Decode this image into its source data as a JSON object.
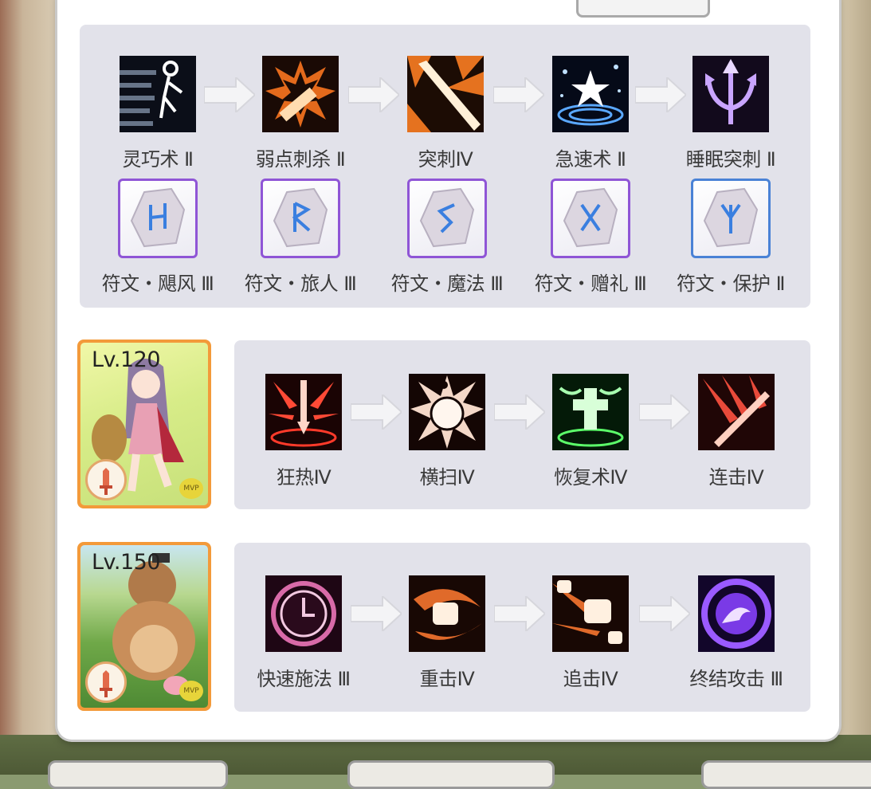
{
  "row1": [
    {
      "label": "灵巧术 Ⅱ",
      "icon": "agility-dash-icon"
    },
    {
      "label": "弱点刺杀 Ⅱ",
      "icon": "weak-point-stab-icon"
    },
    {
      "label": "突刺Ⅳ",
      "icon": "thrust-icon"
    },
    {
      "label": "急速术 Ⅱ",
      "icon": "haste-icon"
    },
    {
      "label": "睡眠突刺 Ⅱ",
      "icon": "sleep-thrust-icon"
    }
  ],
  "runes": [
    {
      "label": "符文・飓风 Ⅲ",
      "icon": "rune-hurricane-icon"
    },
    {
      "label": "符文・旅人 Ⅲ",
      "icon": "rune-traveler-icon"
    },
    {
      "label": "符文・魔法 Ⅲ",
      "icon": "rune-magic-icon"
    },
    {
      "label": "符文・赠礼 Ⅲ",
      "icon": "rune-gift-icon"
    },
    {
      "label": "符文・保护 Ⅱ",
      "icon": "rune-protection-icon"
    }
  ],
  "card1": {
    "level": "Lv.120",
    "mvp": "MVP"
  },
  "row2": [
    {
      "label": "狂热Ⅳ",
      "icon": "frenzy-icon"
    },
    {
      "label": "横扫Ⅳ",
      "icon": "sweep-icon"
    },
    {
      "label": "恢复术Ⅳ",
      "icon": "heal-cross-icon"
    },
    {
      "label": "连击Ⅳ",
      "icon": "combo-strike-icon"
    }
  ],
  "card2": {
    "level": "Lv.150",
    "mvp": "MVP"
  },
  "row3": [
    {
      "label": "快速施法 Ⅲ",
      "icon": "quick-cast-clock-icon"
    },
    {
      "label": "重击Ⅳ",
      "icon": "heavy-punch-icon"
    },
    {
      "label": "追击Ⅳ",
      "icon": "pursuit-punch-icon"
    },
    {
      "label": "终结攻击 Ⅲ",
      "icon": "finishing-attack-icon"
    }
  ],
  "colors": {
    "rune_purple": "#8f55d6",
    "rune_blue": "#4a82d6",
    "card_orange": "#f39a3a"
  }
}
